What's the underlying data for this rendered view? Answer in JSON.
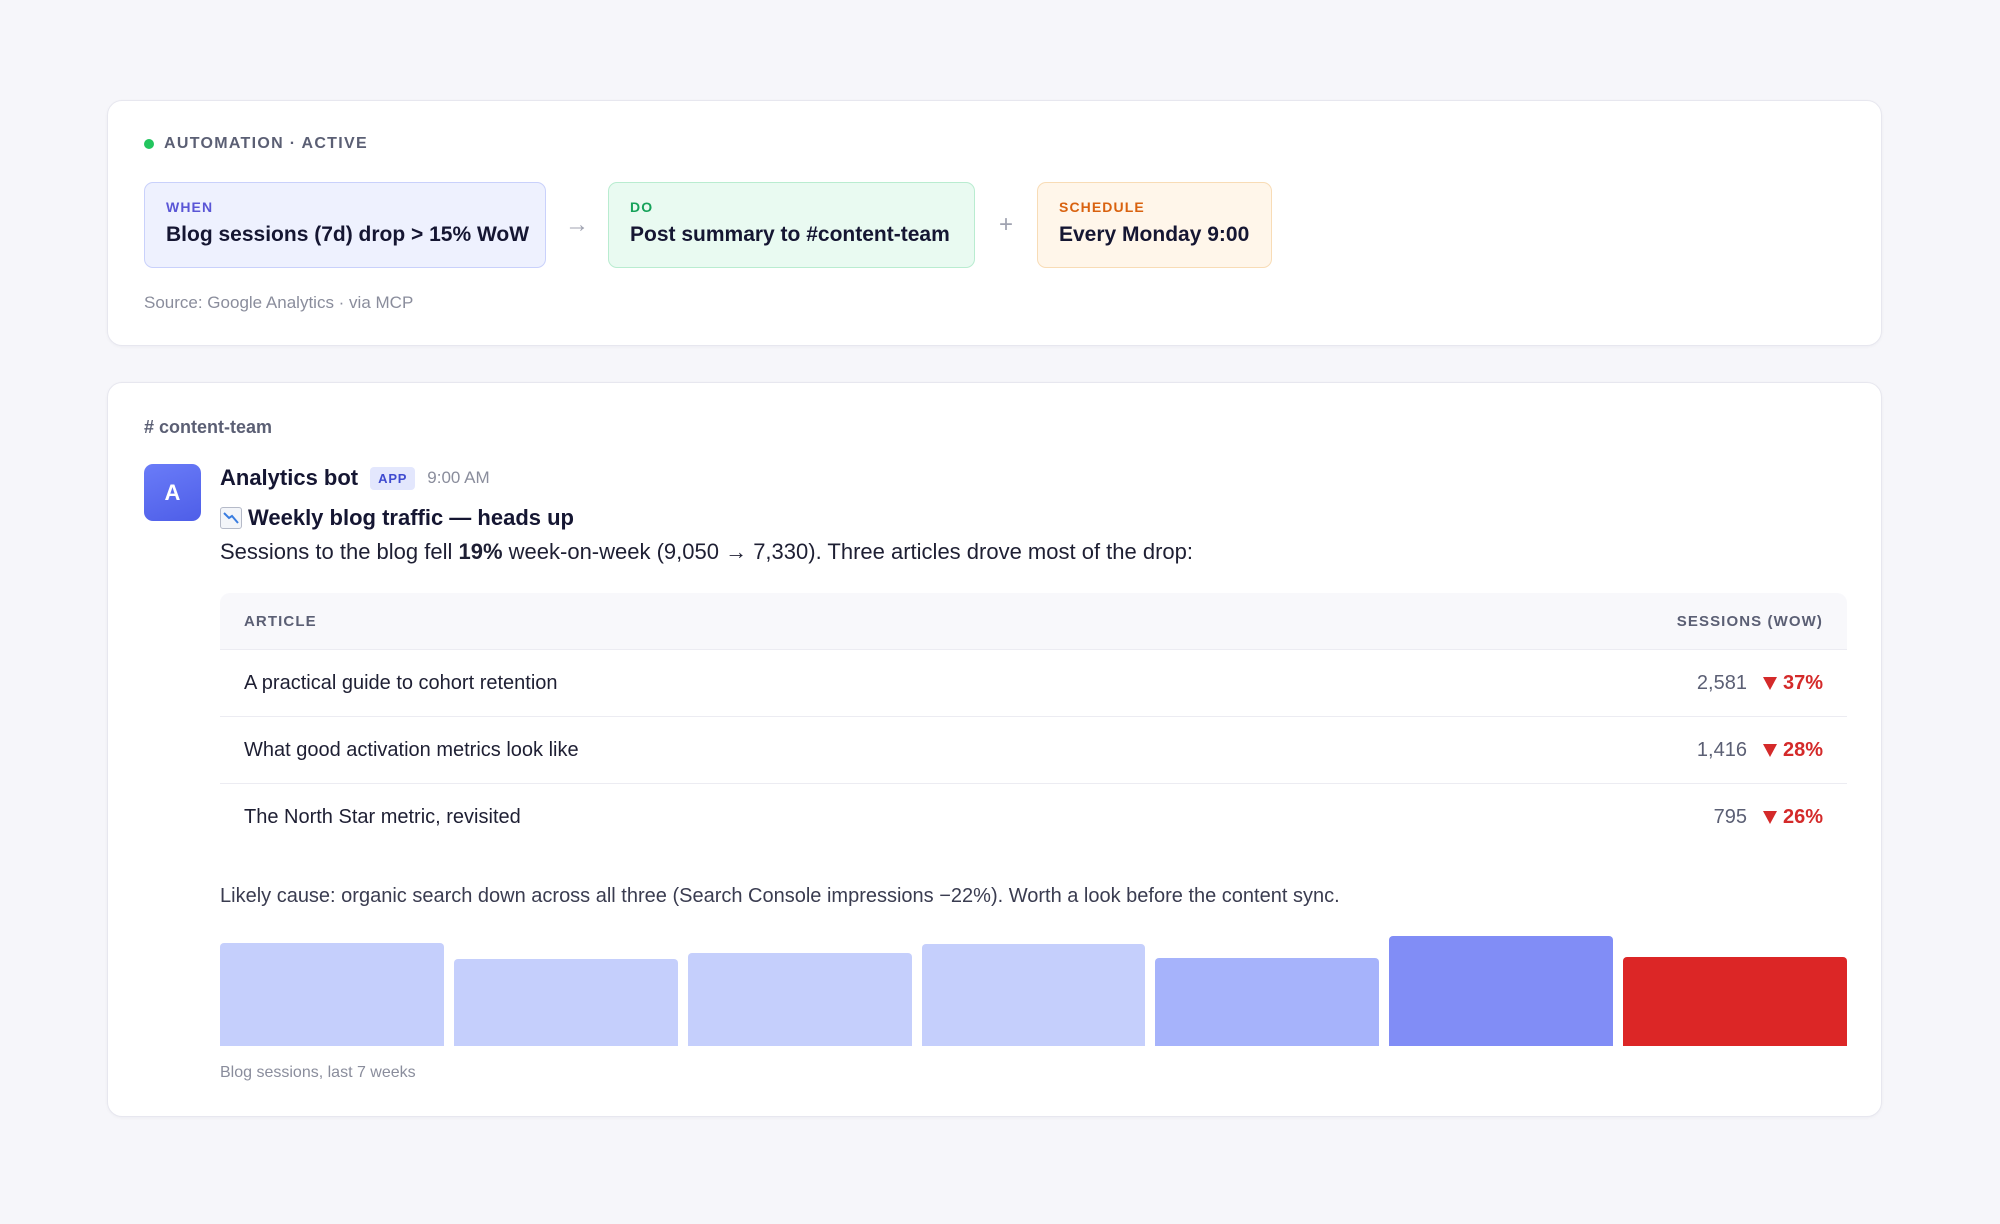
{
  "automation": {
    "status": "AUTOMATION · ACTIVE",
    "status_color": "#22c55e",
    "when": {
      "label": "WHEN",
      "value": "Blog sessions (7d) drop > 15% WoW",
      "label_color": "#5a56d6"
    },
    "arrow": "→",
    "do": {
      "label": "DO",
      "value": "Post summary to #content-team",
      "label_color": "#16a25a"
    },
    "plus": "+",
    "schedule": {
      "label": "SCHEDULE",
      "value": "Every Monday 9:00",
      "label_color": "#d9620f"
    },
    "source": "Source: Google Analytics · via MCP"
  },
  "channel": {
    "name": "# content-team",
    "message": {
      "avatar_letter": "A",
      "author": "Analytics bot",
      "badge": "APP",
      "time": "9:00 AM",
      "title_icon": "chart-decreasing-icon",
      "title": "Weekly blog traffic — heads up",
      "body_prefix": "Sessions to the blog fell ",
      "body_bold": "19%",
      "body_suffix": " week-on-week (9,050 → 7,330). Three articles drove most of the drop:",
      "table": {
        "columns": [
          "ARTICLE",
          "SESSIONS (WOW)"
        ],
        "rows": [
          {
            "article": "A practical guide to cohort retention",
            "sessions": "2,581",
            "change": "37%"
          },
          {
            "article": "What good activation metrics look like",
            "sessions": "1,416",
            "change": "28%"
          },
          {
            "article": "The North Star metric, revisited",
            "sessions": "795",
            "change": "26%"
          }
        ]
      },
      "cause": "Likely cause: organic search down across all three (Search Console impressions −22%). Worth a look before the content sync.",
      "chart_caption": "Blog sessions, last 7 weeks"
    }
  },
  "chart_data": {
    "type": "bar",
    "title": "",
    "categories": [],
    "series": [
      {
        "values": [
          8470,
          7150,
          7690,
          8390,
          7250,
          9050,
          7330
        ]
      }
    ],
    "colors": [
      "#c5cffc",
      "#c5cffc",
      "#c5cffc",
      "#c5cffc",
      "#a6b3fb",
      "#818df6",
      "#dc2626"
    ],
    "caption": "Blog sessions, last 7 weeks",
    "ylim": [
      0,
      9050
    ],
    "grid": false
  }
}
